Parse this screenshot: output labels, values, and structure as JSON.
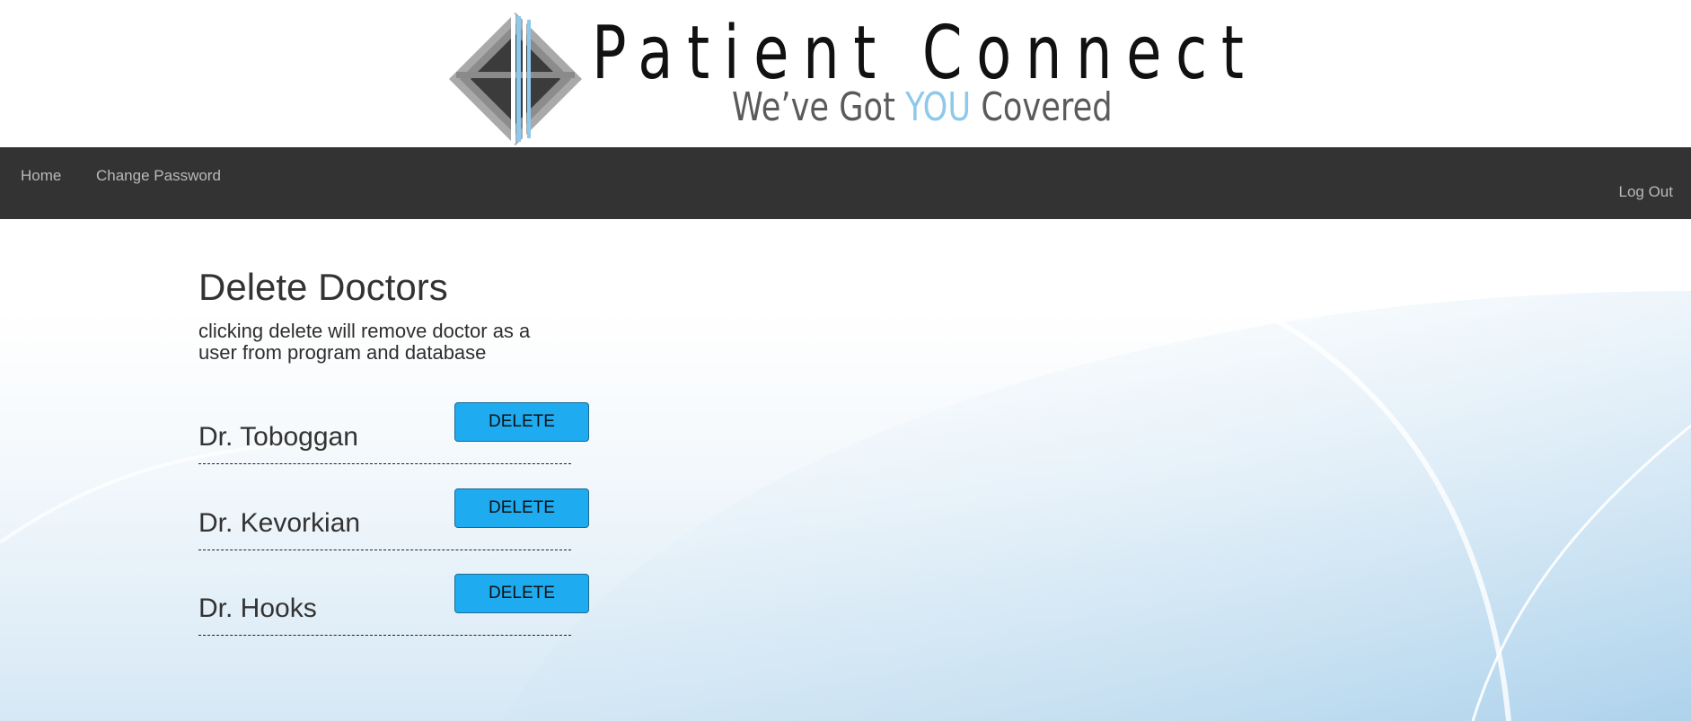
{
  "logo": {
    "title": "Patient Connect",
    "tagline_prefix": "We’ve Got ",
    "tagline_accent": "YOU",
    "tagline_suffix": " Covered",
    "accent_color": "#8ec8ea"
  },
  "nav": {
    "home": "Home",
    "change_password": "Change Password",
    "log_out": "Log Out"
  },
  "page": {
    "title": "Delete Doctors",
    "description": "clicking delete will remove doctor as a user from program and database"
  },
  "doctors": [
    {
      "name": "Dr. Toboggan",
      "action": "DELETE"
    },
    {
      "name": "Dr. Kevorkian",
      "action": "DELETE"
    },
    {
      "name": "Dr. Hooks",
      "action": "DELETE"
    }
  ],
  "colors": {
    "navbar": "#333333",
    "button": "#1eabf0",
    "text": "#333333"
  }
}
